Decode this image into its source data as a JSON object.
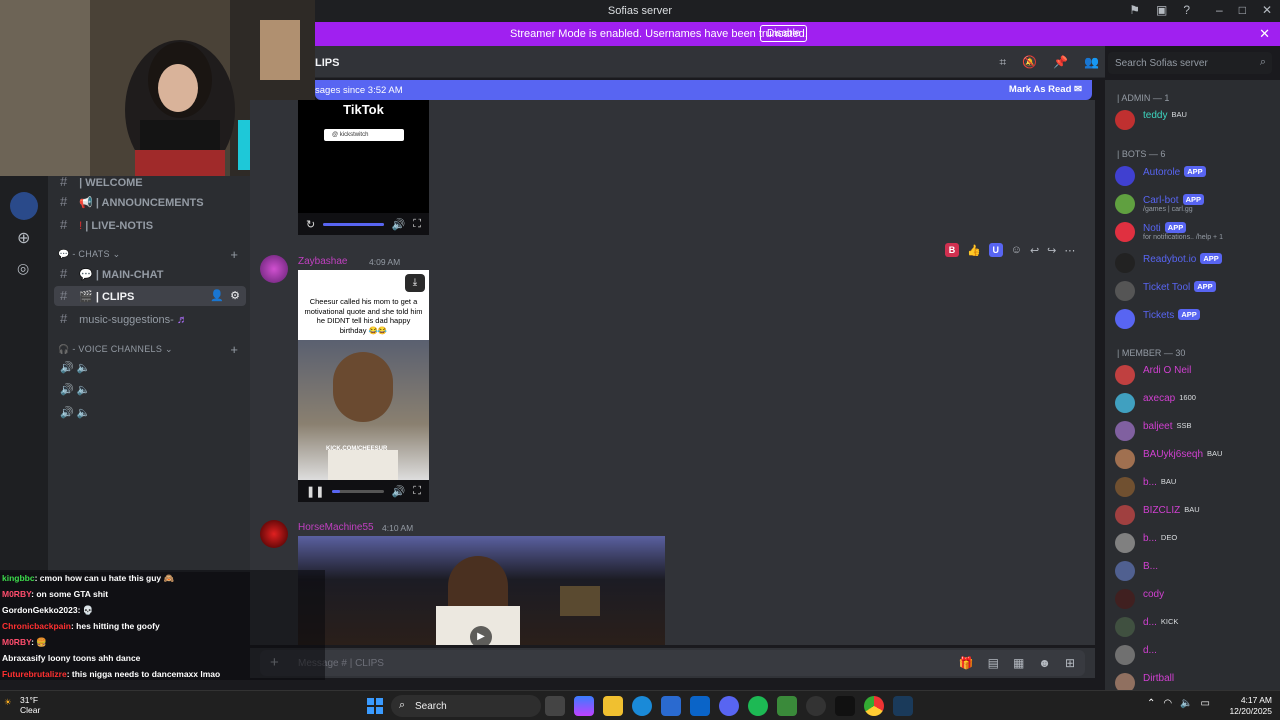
{
  "window": {
    "title": "Sofias server"
  },
  "banner": {
    "message": "Streamer Mode is enabled. Usernames have been truncated.",
    "disable_label": "Disable"
  },
  "header": {
    "channel": "LIPS",
    "search_placeholder": "Search Sofias server"
  },
  "newbar": {
    "text": "sages since 3:52 AM",
    "mark_label": "Mark As Read"
  },
  "sidebar": {
    "channels_top": [
      {
        "label": "| WELCOME"
      },
      {
        "label": "| ANNOUNCEMENTS"
      },
      {
        "label": "| LIVE-NOTIS"
      }
    ],
    "chats_category": "- CHATS",
    "chats": [
      {
        "label": "| MAIN-CHAT"
      },
      {
        "label": "| CLIPS"
      },
      {
        "label": "music-suggestions-"
      }
    ],
    "voice_category": "- VOICE CHANNELS"
  },
  "messages": [
    {
      "video_caption_top": "TikTok",
      "search_text": "@ kickstwitch"
    },
    {
      "user": "Zaybashae",
      "time": "4:09 AM",
      "caption": "Cheesur called his mom to get a motivational quote and she told him he DIDNT tell his dad happy birthday 😂😂",
      "watermark": "KICK.COM/CHEESUR",
      "progress": 0.15
    },
    {
      "user": "HorseMachine55",
      "time": "4:10 AM"
    }
  ],
  "reactbar": {
    "tags": [
      "B",
      "U"
    ]
  },
  "message_input": {
    "placeholder": "Message # | CLIPS"
  },
  "members": {
    "admin_header": "| ADMIN — 1",
    "admins": [
      {
        "name": "teddy",
        "tag": "BAU"
      }
    ],
    "bots_header": "| BOTS — 6",
    "bots": [
      {
        "name": "Autorole",
        "badge": "APP"
      },
      {
        "name": "Carl-bot",
        "badge": "APP",
        "sub": "/games | carl.gg"
      },
      {
        "name": "Noti",
        "badge": "APP",
        "sub": "for notifications.. /help + 1"
      },
      {
        "name": "Readybot.io",
        "badge": "APP"
      },
      {
        "name": "Ticket Tool",
        "badge": "APP"
      },
      {
        "name": "Tickets",
        "badge": "APP"
      }
    ],
    "member_header": "| MEMBER — 30",
    "people": [
      {
        "name": "Ardi O Neil",
        "tag": ""
      },
      {
        "name": "axecap",
        "tag": "1600"
      },
      {
        "name": "baljeet",
        "tag": "SSB"
      },
      {
        "name": "BAUykj6seqh",
        "tag": "BAU"
      },
      {
        "name": "b...",
        "tag": "BAU"
      },
      {
        "name": "BIZCLIZ",
        "tag": "BAU"
      },
      {
        "name": "b...",
        "tag": "DEO"
      },
      {
        "name": "B...",
        "tag": ""
      },
      {
        "name": "cody",
        "tag": ""
      },
      {
        "name": "d...",
        "tag": "KICK"
      },
      {
        "name": "d...",
        "tag": ""
      },
      {
        "name": "Dirtball",
        "tag": ""
      }
    ]
  },
  "stream_chat": [
    {
      "user": "kingbbc",
      "text": ": cmon how can u hate this guy 🙈",
      "color": "#3ddc4c"
    },
    {
      "user": "M0RBY",
      "text": ": on some GTA shit",
      "color": "#ff4d6d"
    },
    {
      "user": "GordonGekko2023",
      "text": ": 💀",
      "color": "#ffffff"
    },
    {
      "user": "Chronicbackpain",
      "text": ": hes hitting the goofy",
      "color": "#ff3030"
    },
    {
      "user": "M0RBY",
      "text": ": 🍔",
      "color": "#ff4d6d"
    },
    {
      "user": "Abraxasify",
      "text": " loony toons ahh dance",
      "color": "#ffffff"
    },
    {
      "user": "Futurebrutalizre",
      "text": ": this nigga needs to dancemaxx lmao",
      "color": "#ff3030"
    }
  ],
  "taskbar": {
    "temp": "31°F",
    "weather": "Clear",
    "search_label": "Search",
    "time": "4:17 AM",
    "date": "12/20/2025"
  }
}
